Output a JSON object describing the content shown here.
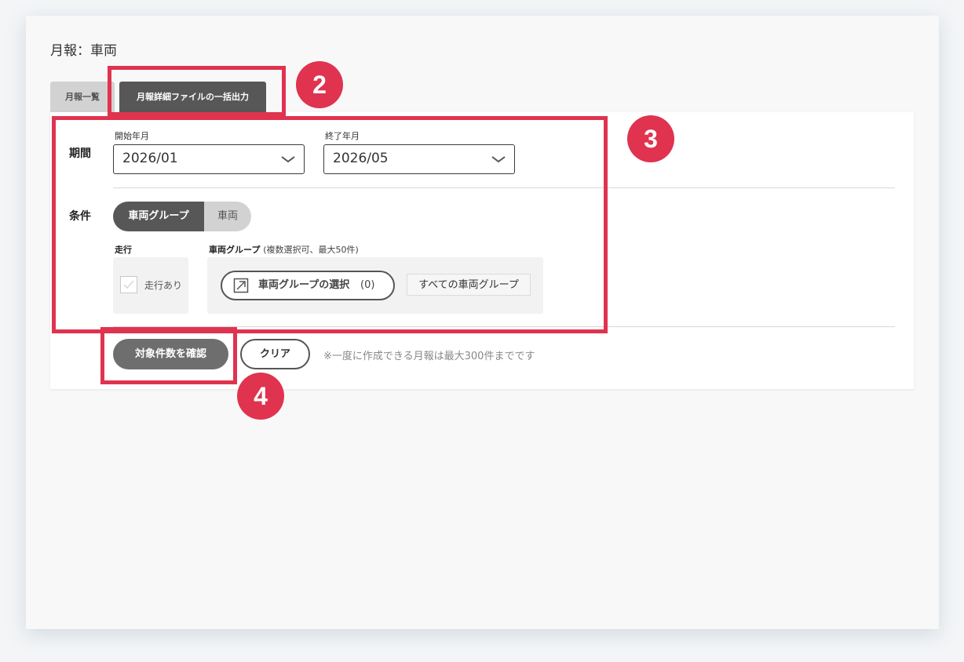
{
  "page_title": "月報：車両",
  "tabs": [
    {
      "label": "月報一覧"
    },
    {
      "label": "月報詳細ファイルの一括出力"
    }
  ],
  "period": {
    "label": "期間",
    "start": {
      "label": "開始年月",
      "value": "2026/01"
    },
    "end": {
      "label": "終了年月",
      "value": "2026/05"
    }
  },
  "conditions": {
    "label": "条件",
    "segments": [
      {
        "label": "車両グループ",
        "selected": true
      },
      {
        "label": "車両",
        "selected": false
      }
    ],
    "running": {
      "heading": "走行",
      "checkbox_label": "走行あり"
    },
    "vehicle_group": {
      "heading": "車両グループ",
      "note": "(複数選択可、最大50件)",
      "select_label": "車両グループの選択",
      "count": "(0)",
      "all_tag": "すべての車両グループ"
    }
  },
  "actions": {
    "confirm": "対象件数を確認",
    "clear": "クリア",
    "note": "※一度に作成できる月報は最大300件までです"
  },
  "badges": [
    "2",
    "3",
    "4"
  ],
  "colors": {
    "highlight": "#e0334f",
    "dark_button": "#575757"
  }
}
